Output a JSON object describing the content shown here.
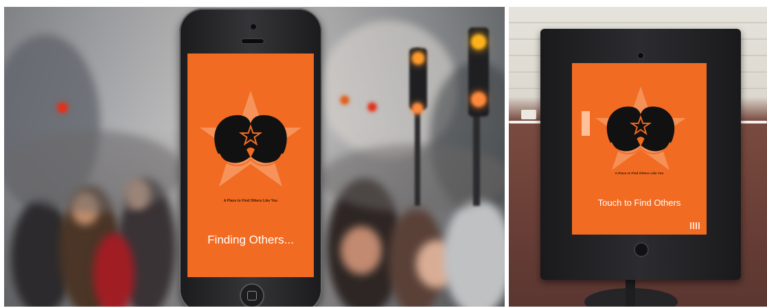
{
  "left_photo": {
    "phone_screen": {
      "tagline": "A Place to Find Others Like You",
      "status": "Finding Others..."
    }
  },
  "right_photo": {
    "kiosk_screen": {
      "tagline": "A Place to Find Others Like You",
      "status": "Touch to Find Others"
    }
  },
  "colors": {
    "screen_orange": "#f26b22",
    "logo_black": "#111111",
    "star_light": "#f7a06e"
  },
  "icons": [
    "star-icon",
    "heart-logo-icon",
    "home-button-icon"
  ]
}
